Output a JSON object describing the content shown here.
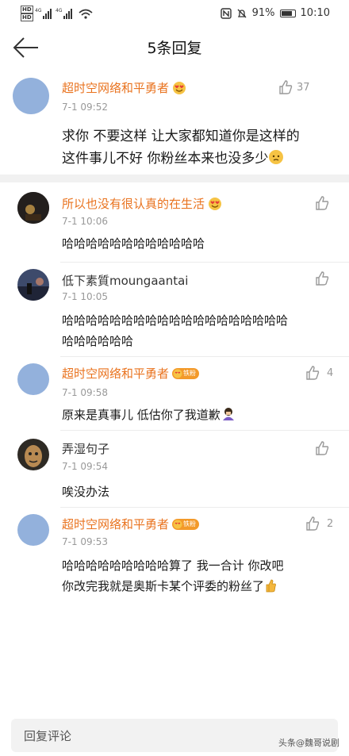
{
  "status_bar": {
    "battery": "91%",
    "battery_level": 0.91,
    "time": "10:10",
    "sim1": "HD",
    "sim2": "HD",
    "net1": "4G",
    "net2": "4G"
  },
  "header": {
    "title": "5条回复"
  },
  "main_comment": {
    "author": "超时空网络和平勇者",
    "time": "7-1 09:52",
    "likes": "37",
    "text_line1": "求你 不要这样 让大家都知道你是这样的",
    "text_line2": "这件事儿不好 你粉丝本来也没多少"
  },
  "replies": [
    {
      "author": "所以也没有很认真的在生活",
      "time": "7-1 10:06",
      "text": "哈哈哈哈哈哈哈哈哈哈哈哈"
    },
    {
      "author": "低下素質moungaantai",
      "time": "7-1 10:05",
      "line1": "哈哈哈哈哈哈哈哈哈哈哈哈哈哈哈哈哈哈哈",
      "line2": "哈哈哈哈哈哈"
    },
    {
      "author": "超时空网络和平勇者",
      "badge": "铁粉",
      "time": "7-1 09:58",
      "likes": "4",
      "text": "原来是真事儿 低估你了我道歉"
    },
    {
      "author": "弄湿句子",
      "time": "7-1 09:54",
      "text": "唉没办法"
    },
    {
      "author": "超时空网络和平勇者",
      "badge": "铁粉",
      "time": "7-1 09:53",
      "likes": "2",
      "line1": "哈哈哈哈哈哈哈哈哈算了 我一合计 你改吧",
      "line2": "你改完我就是奥斯卡某个评委的粉丝了"
    }
  ],
  "reply_bar": {
    "placeholder": "回复评论"
  },
  "watermark": "头条@魏哥说剧",
  "colors": {
    "accent_orange": "#e9731f",
    "avatar_blue": "#93b1dc",
    "badge_orange": "#f39a2a"
  }
}
